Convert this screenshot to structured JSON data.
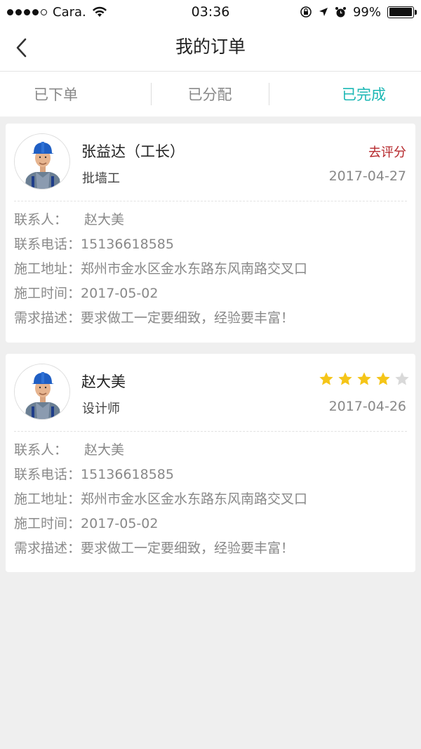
{
  "status_bar": {
    "carrier": "Cara.",
    "time": "03:36",
    "battery": "99%",
    "battery_level": 0.99,
    "signal_icons": [
      "signal-dot-icon",
      "wifi-icon",
      "lock-rotation-icon",
      "location-icon",
      "alarm-icon",
      "battery-icon"
    ]
  },
  "nav": {
    "title": "我的订单",
    "back_icon": "chevron-left-icon"
  },
  "tabs": [
    {
      "label": "已下单",
      "active": false
    },
    {
      "label": "已分配",
      "active": false
    },
    {
      "label": "已完成",
      "active": true
    }
  ],
  "colors": {
    "accent": "#1bb7b4",
    "rate_link": "#b5272b",
    "star_on": "#f5c518",
    "star_off": "#d9d9d9"
  },
  "orders": [
    {
      "name": "张益达（工长）",
      "role": "批墙工",
      "action": "去评分",
      "date": "2017-04-27",
      "info": [
        {
          "label": "联系人：",
          "value": "赵大美"
        },
        {
          "label": "联系电话：",
          "value": "15136618585"
        },
        {
          "label": "施工地址：",
          "value": "郑州市金水区金水东路东风南路交叉口"
        },
        {
          "label": "施工时间：",
          "value": "2017-05-02"
        },
        {
          "label": "需求描述：",
          "value": "要求做工一定要细致，经验要丰富！"
        }
      ]
    },
    {
      "name": "赵大美",
      "role": "设计师",
      "rating": 4,
      "rating_max": 5,
      "date": "2017-04-26",
      "info": [
        {
          "label": "联系人：",
          "value": "赵大美"
        },
        {
          "label": "联系电话：",
          "value": "15136618585"
        },
        {
          "label": "施工地址：",
          "value": "郑州市金水区金水东路东风南路交叉口"
        },
        {
          "label": "施工时间：",
          "value": "2017-05-02"
        },
        {
          "label": "需求描述：",
          "value": "要求做工一定要细致，经验要丰富！"
        }
      ]
    }
  ]
}
